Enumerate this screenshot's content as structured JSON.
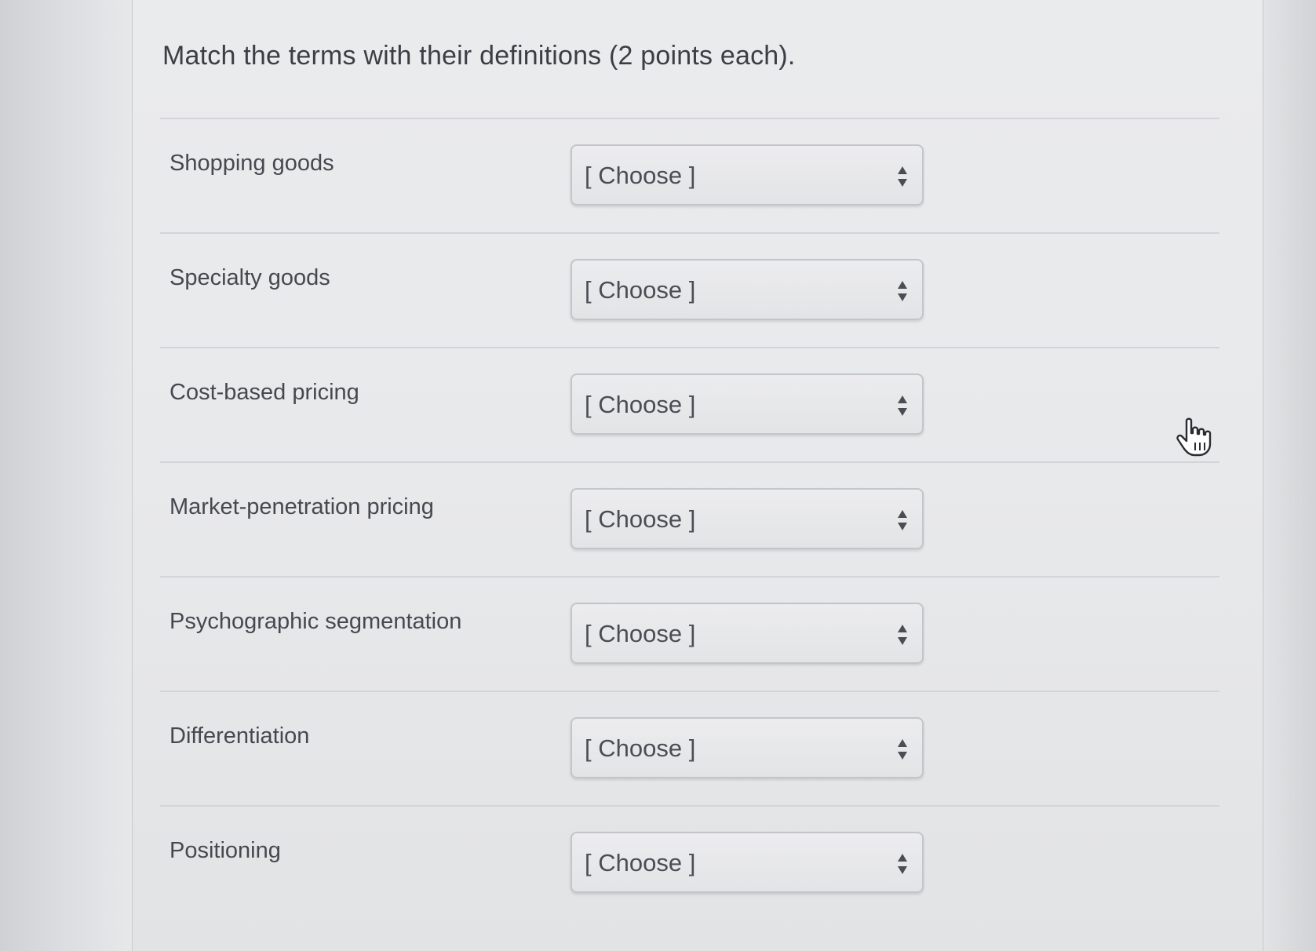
{
  "question": {
    "title": "Match the terms with their definitions (2 points each)."
  },
  "rows": [
    {
      "term": "Shopping goods",
      "select_value": "[ Choose ]"
    },
    {
      "term": "Specialty goods",
      "select_value": "[ Choose ]"
    },
    {
      "term": "Cost-based pricing",
      "select_value": "[ Choose ]"
    },
    {
      "term": "Market-penetration pricing",
      "select_value": "[ Choose ]"
    },
    {
      "term": "Psychographic segmentation",
      "select_value": "[ Choose ]"
    },
    {
      "term": "Differentiation",
      "select_value": "[ Choose ]"
    },
    {
      "term": "Positioning",
      "select_value": "[ Choose ]"
    }
  ],
  "icons": {
    "select_arrows": "up-down-arrows-icon",
    "cursor": "hand-pointer-icon"
  },
  "colors": {
    "text": "#3b3f45",
    "select_border": "#c3c5c8",
    "divider": "#d3d4d7"
  }
}
